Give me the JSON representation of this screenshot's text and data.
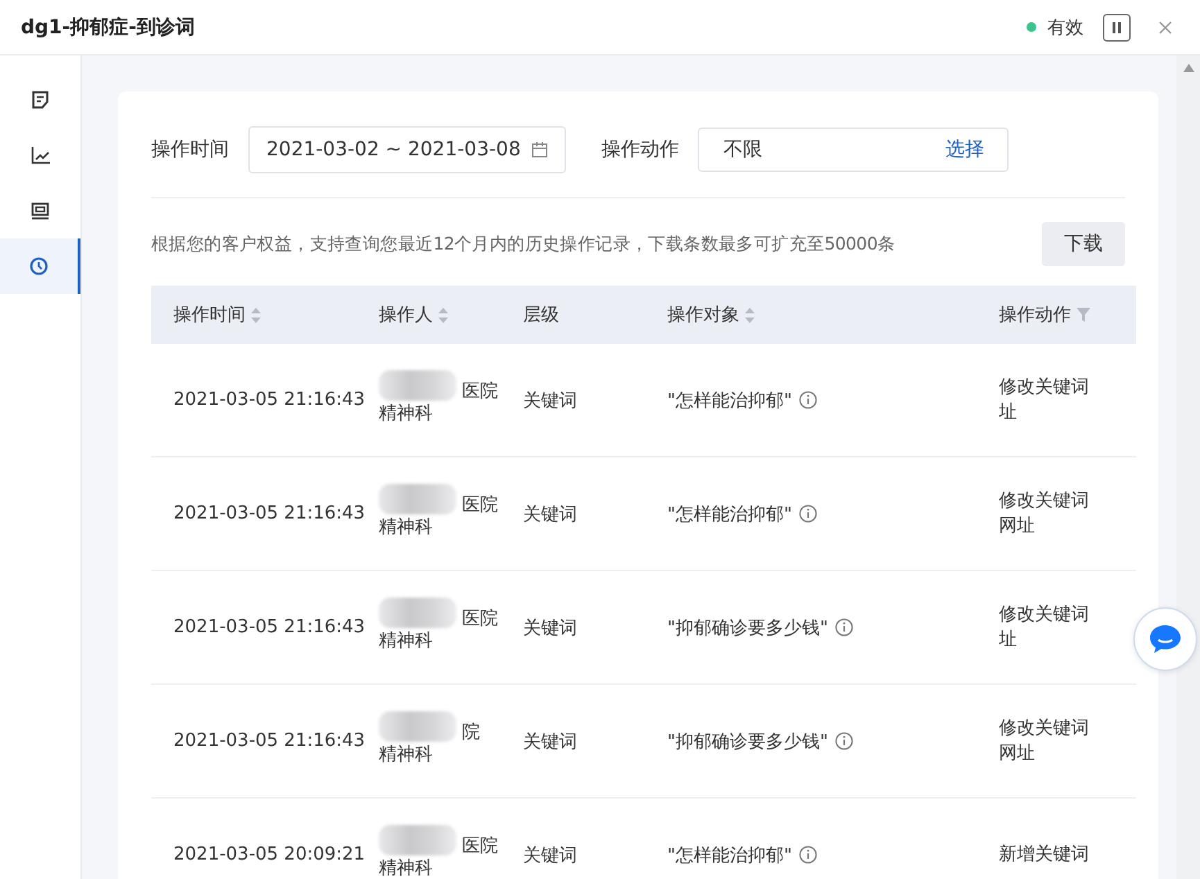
{
  "window": {
    "title": "dg1-抑郁症-到诊词",
    "status": {
      "label": "有效",
      "color": "#3cc48d"
    }
  },
  "sidebar": {
    "items": [
      {
        "kind": "note",
        "selected": false
      },
      {
        "kind": "chart",
        "selected": false
      },
      {
        "kind": "card",
        "selected": false
      },
      {
        "kind": "clock",
        "selected": true
      }
    ]
  },
  "filters": {
    "time_label": "操作时间",
    "date_range": "2021-03-02 ~ 2021-03-08",
    "action_label": "操作动作",
    "action_value": "不限",
    "action_button": "选择"
  },
  "notice": "根据您的客户权益，支持查询您最近12个月内的历史操作记录，下载条数最多可扩充至50000条",
  "download_button": "下载",
  "table": {
    "columns": [
      {
        "label": "操作时间",
        "kind": "sort"
      },
      {
        "label": "操作人",
        "kind": "sort"
      },
      {
        "label": "层级",
        "kind": "plain"
      },
      {
        "label": "操作对象",
        "kind": "sort"
      },
      {
        "label": "操作动作",
        "kind": "filter"
      }
    ],
    "rows": [
      {
        "time": "2021-03-05 21:16:43",
        "operator": [
          "医院",
          "精神科"
        ],
        "level": "关键词",
        "object": "\"怎样能治抑郁\"",
        "action": [
          "修改关键词",
          "址"
        ]
      },
      {
        "time": "2021-03-05 21:16:43",
        "operator": [
          "医院",
          "精神科"
        ],
        "level": "关键词",
        "object": "\"怎样能治抑郁\"",
        "action": [
          "修改关键词",
          "网址"
        ]
      },
      {
        "time": "2021-03-05 21:16:43",
        "operator": [
          "医院",
          "精神科"
        ],
        "level": "关键词",
        "object": "\"抑郁确诊要多少钱\"",
        "action": [
          "修改关键词",
          "址"
        ]
      },
      {
        "time": "2021-03-05 21:16:43",
        "operator": [
          "院",
          "精神科"
        ],
        "level": "关键词",
        "object": "\"抑郁确诊要多少钱\"",
        "action": [
          "修改关键词",
          "网址"
        ]
      },
      {
        "time": "2021-03-05 20:09:21",
        "operator": [
          "医院",
          "精神科"
        ],
        "level": "关键词",
        "object": "\"怎样能治抑郁\"",
        "action": [
          "新增关键词"
        ]
      }
    ]
  }
}
